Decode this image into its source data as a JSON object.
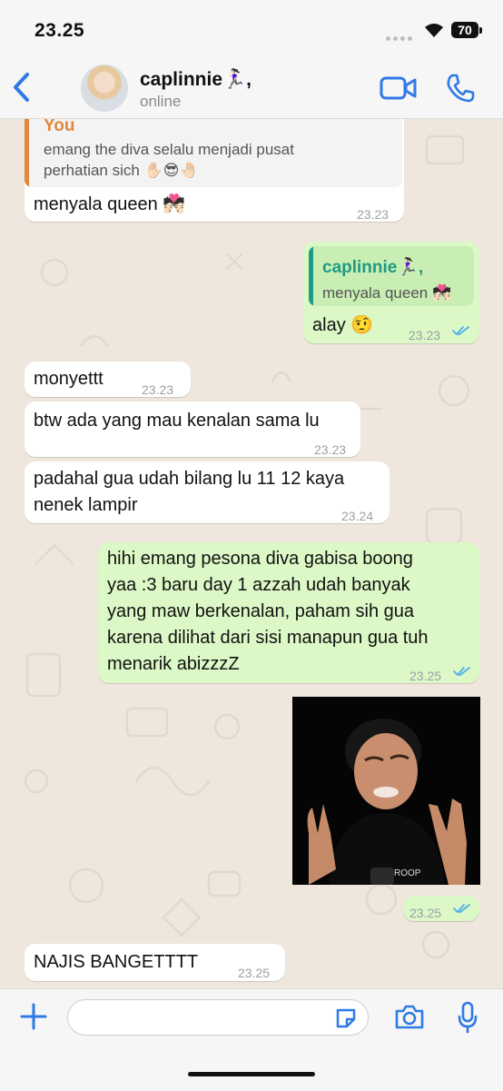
{
  "status_bar": {
    "time": "23.25",
    "battery": "70"
  },
  "header": {
    "contact_name": "caplinnie🏃🏻‍♀️,",
    "contact_status": "online"
  },
  "messages": [
    {
      "quote_author": "You",
      "quote_text": "emang the diva selalu menjadi pusat perhatian sich ✋🏻😎🤚🏻",
      "text": "menyala queen 💏🏻",
      "time": "23.23"
    },
    {
      "quote_author": "caplinnie🏃🏻‍♀️,",
      "quote_text": "menyala queen 💏🏻",
      "text": "alay 🤨",
      "time": "23.23"
    },
    {
      "text": "monyettt",
      "time": "23.23"
    },
    {
      "text": "btw ada yang mau kenalan sama lu",
      "time": "23.23"
    },
    {
      "line1": "padahal gua udah bilang lu 11 12 kaya",
      "line2": "nenek lampir",
      "time": "23.24"
    },
    {
      "line1": "hihi emang pesona diva gabisa boong",
      "line2": "yaa :3 baru day 1 azzah udah banyak",
      "line3": "yang maw berkenalan, paham sih gua",
      "line4": "karena dilihat dari sisi manapun gua tuh",
      "line5": "menarik abizzzZ",
      "time": "23.25"
    },
    {
      "photo_text": "ROOP",
      "time": "23.25"
    },
    {
      "text": "NAJIS BANGETTTT",
      "time": "23.25"
    }
  ],
  "input": {
    "placeholder": "",
    "value": ""
  },
  "colors": {
    "accent_blue": "#2f7ae5",
    "quote_orange": "#e0883c",
    "quote_teal": "#1f9a84",
    "outgoing_bubble": "#dbf8c6",
    "read_ticks": "#4fb0e8"
  }
}
